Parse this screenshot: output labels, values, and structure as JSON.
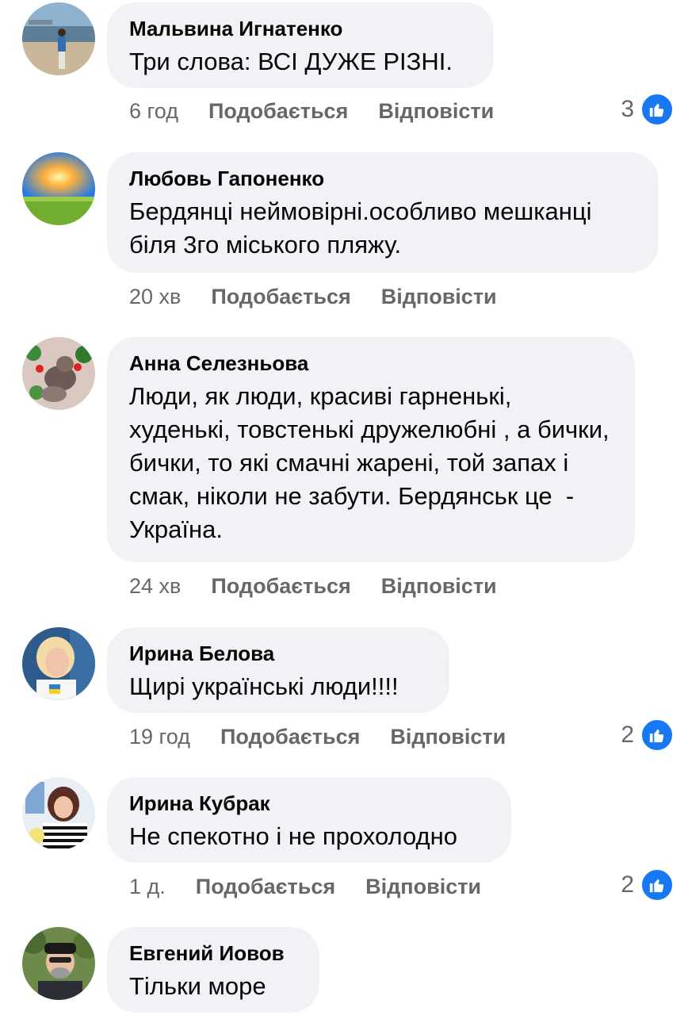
{
  "colors": {
    "bubble": "#f0f2f5",
    "meta_text": "#65676b",
    "like_accent": "#1877f2"
  },
  "comments": [
    {
      "author": "Мальвина Игнатенко",
      "text": "Три слова: ВСІ ДУЖЕ РІЗНІ.",
      "time": "6 год",
      "like_label": "Подобається",
      "reply_label": "Відповісти",
      "reaction_count": "3",
      "avatar_icon": "avatar-photo-seaside"
    },
    {
      "author": "Любовь Гапоненко",
      "text": "Бердянці неймовірні.особливо мешканці біля 3го міського пляжу.",
      "time": "20 хв",
      "like_label": "Подобається",
      "reply_label": "Відповісти",
      "reaction_count": null,
      "avatar_icon": "avatar-photo-sunset"
    },
    {
      "author": "Анна Селезньова",
      "text": "Люди, як люди, красиві гарненькі, худенькі, товстенькі дружелюбні , а бички, бички, то які смачні жарені, той запах і смак, ніколи не забути. Бердянськ це  - Україна.",
      "time": "24 хв",
      "like_label": "Подобається",
      "reply_label": "Відповісти",
      "reaction_count": null,
      "avatar_icon": "avatar-photo-cats"
    },
    {
      "author": "Ирина Белова",
      "text": "Щирі українські люди!!!!",
      "time": "19 год",
      "like_label": "Подобається",
      "reply_label": "Відповісти",
      "reaction_count": "2",
      "avatar_icon": "avatar-photo-woman"
    },
    {
      "author": "Ирина Кубрак",
      "text": "Не спекотно і не прохолодно",
      "time": "1 д.",
      "like_label": "Подобається",
      "reply_label": "Відповісти",
      "reaction_count": "2",
      "avatar_icon": "avatar-photo-woman-striped"
    },
    {
      "author": "Евгений Иовов",
      "text": "Тільки море",
      "time": null,
      "like_label": null,
      "reply_label": null,
      "reaction_count": null,
      "avatar_icon": "avatar-photo-man-cap"
    }
  ]
}
